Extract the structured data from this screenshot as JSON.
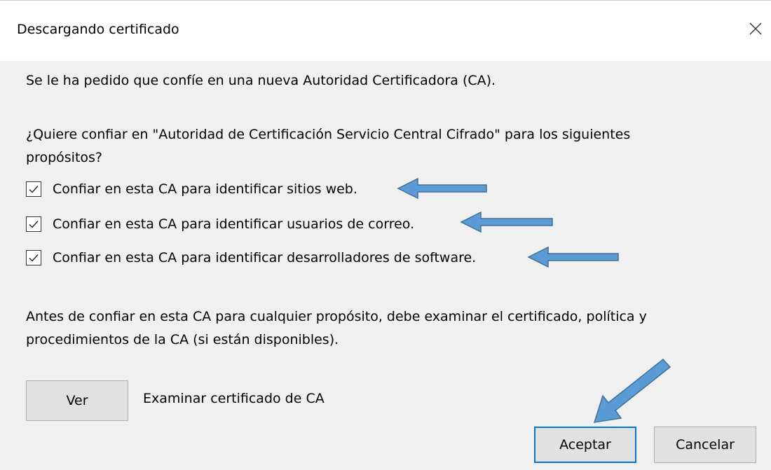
{
  "dialog": {
    "title": "Descargando certificado",
    "intro": "Se le ha pedido que confíe en una nueva Autoridad Certificadora (CA).",
    "question_line1": "¿Quiere confiar en \"Autoridad de Certificación Servicio Central Cifrado\" para los siguientes",
    "question_line2": "propósitos?",
    "checkboxes": [
      {
        "label": "Confiar en esta CA para identificar sitios web.",
        "checked": true
      },
      {
        "label": "Confiar en esta CA para identificar usuarios de correo.",
        "checked": true
      },
      {
        "label": "Confiar en esta CA para identificar desarrolladores de software.",
        "checked": true
      }
    ],
    "notice_line1": "Antes de confiar en esta CA para cualquier propósito, debe examinar el certificado, política y",
    "notice_line2": "procedimientos de la CA (si están disponibles).",
    "view_button": "Ver",
    "view_caption": "Examinar certificado de CA",
    "ok_button": "Aceptar",
    "cancel_button": "Cancelar"
  },
  "annotation_color": "#5b9bd5",
  "icons": [
    "close-icon",
    "checkmark-icon",
    "arrow-annotation"
  ]
}
